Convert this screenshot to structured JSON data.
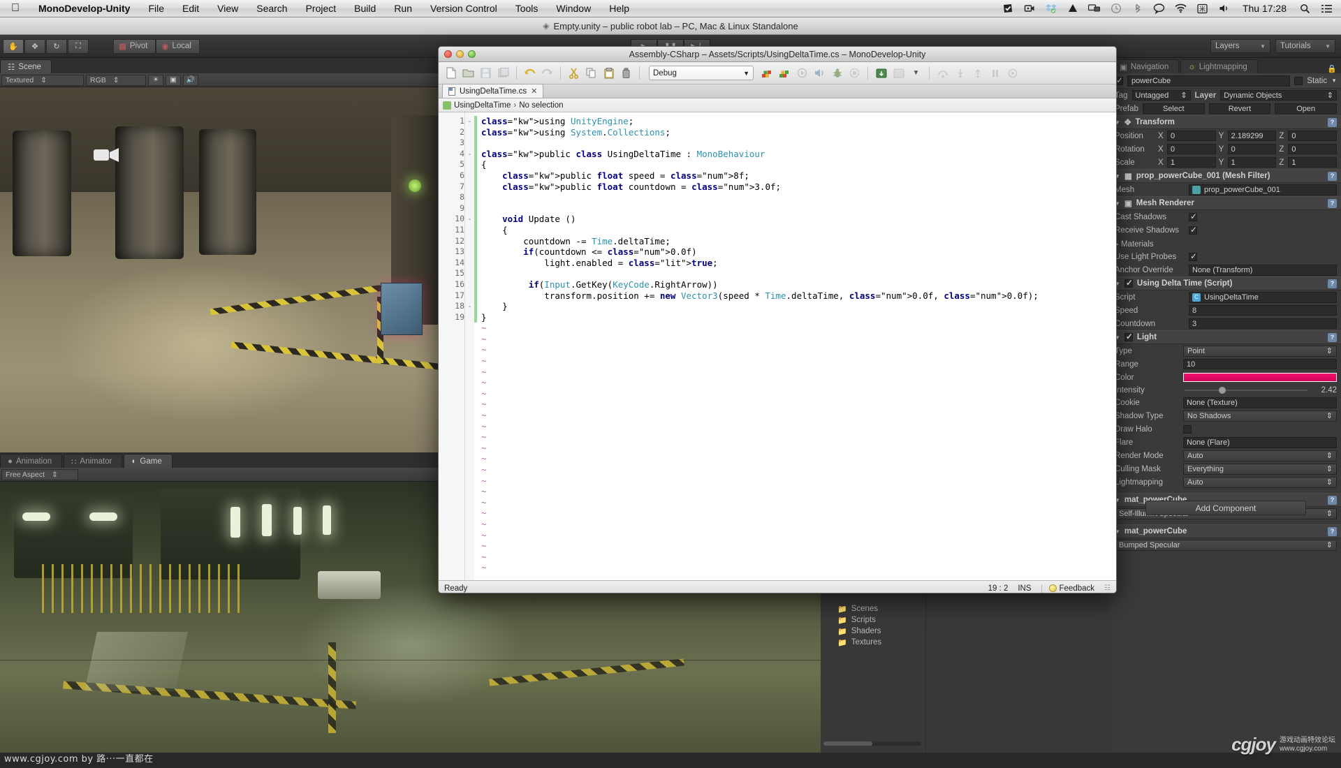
{
  "menubar": {
    "apple_icon": "apple-icon",
    "app_name": "MonoDevelop-Unity",
    "items": [
      "File",
      "Edit",
      "View",
      "Search",
      "Project",
      "Build",
      "Run",
      "Version Control",
      "Tools",
      "Window",
      "Help"
    ],
    "status_icons": [
      "checkmark-badge-icon",
      "screen-record-icon",
      "dropbox-icon",
      "google-drive-icon",
      "display-mirror-icon",
      "time-machine-icon",
      "bluetooth-icon",
      "chat-bubble-icon",
      "wifi-icon",
      "input-menu-icon",
      "volume-icon"
    ],
    "clock": "Thu 17:28",
    "search_icon": "search-icon",
    "notification_icon": "notification-center-icon"
  },
  "unity": {
    "title": "Empty.unity – public robot lab – PC, Mac & Linux Standalone",
    "title_icon": "unity-icon",
    "toolbar": {
      "tools": [
        "hand-tool",
        "move-tool",
        "rotate-tool",
        "scale-tool"
      ],
      "pivot_label": "Pivot",
      "local_label": "Local",
      "play_icon": "play-icon",
      "pause_icon": "pause-icon",
      "step_icon": "step-icon",
      "layers_label": "Layers",
      "tutorials_label": "Tutorials"
    },
    "scene_panel": {
      "tab_label": "Scene",
      "draw_mode": "Textured",
      "render_mode": "RGB",
      "toggles": [
        "lighting-icon",
        "image-effects-icon",
        "audio-icon"
      ]
    },
    "game_panel": {
      "tabs": [
        {
          "label": "Animation",
          "icon": "animation-icon",
          "active": false
        },
        {
          "label": "Animator",
          "icon": "animator-icon",
          "active": false
        },
        {
          "label": "Game",
          "icon": "game-icon",
          "active": true
        }
      ],
      "aspect": "Free Aspect"
    },
    "project_panel": {
      "folders": [
        "Scenes",
        "Scripts",
        "Shaders",
        "Textures"
      ],
      "folder_icon": "folder-icon"
    },
    "inspector": {
      "tabs": [
        {
          "label": "Navigation",
          "icon": "navigation-icon"
        },
        {
          "label": "Lightmapping",
          "icon": "lightmapping-icon"
        }
      ],
      "lock_icon": "lock-icon",
      "object_name": "powerCube",
      "static_label": "Static",
      "tag_label": "Tag",
      "tag_value": "Untagged",
      "layer_label": "Layer",
      "layer_value": "Dynamic Objects",
      "prefab_label": "Prefab",
      "prefab_buttons": [
        "Select",
        "Revert",
        "Open"
      ],
      "transform": {
        "header": "Transform",
        "rows": [
          {
            "label": "Position",
            "x": "0",
            "y": "2.189299",
            "z": "0"
          },
          {
            "label": "Rotation",
            "x": "0",
            "y": "0",
            "z": "0"
          },
          {
            "label": "Scale",
            "x": "1",
            "y": "1",
            "z": "1"
          }
        ]
      },
      "mesh_filter": {
        "header": "prop_powerCube_001 (Mesh Filter)",
        "mesh_label": "Mesh",
        "mesh_value": "prop_powerCube_001"
      },
      "mesh_renderer": {
        "header": "Mesh Renderer",
        "rows": [
          {
            "label": "Cast Shadows",
            "checked": true
          },
          {
            "label": "Receive Shadows",
            "checked": true
          },
          {
            "label": "Use Light Probes",
            "checked": true
          }
        ],
        "anchor_label": "Anchor Override",
        "anchor_value": "None (Transform)"
      },
      "script_comp": {
        "header": "Using Delta Time (Script)",
        "script_label": "Script",
        "script_value": "UsingDeltaTime",
        "speed_label": "Speed",
        "speed_value": "8",
        "countdown_label": "Countdown",
        "countdown_value": "3"
      },
      "light_comp": {
        "header": "Light",
        "type_label": "Type",
        "type_value": "Point",
        "range_label": "Range",
        "range_value": "10",
        "color_label": "Color",
        "color_value": "#F2126B",
        "intensity_label": "Intensity",
        "intensity_value": "2.42",
        "cookie_label": "Cookie",
        "cookie_value": "None (Texture)",
        "shadow_label": "Shadow Type",
        "shadow_value": "No Shadows",
        "draw_halo_label": "Draw Halo",
        "flare_label": "Flare",
        "flare_value": "None (Flare)",
        "render_mode_label": "Render Mode",
        "render_mode_value": "Auto",
        "culling_label": "Culling Mask",
        "culling_value": "Everything",
        "lightmapping_label": "Lightmapping",
        "lightmapping_value": "Auto"
      },
      "materials": [
        {
          "name": "mat_powerCube",
          "shader": "Self-Illumin/Specular"
        },
        {
          "name": "mat_powerCube",
          "shader": "Bumped Specular"
        }
      ],
      "add_component": "Add Component"
    }
  },
  "monodevelop": {
    "title": "Assembly-CSharp – Assets/Scripts/UsingDeltaTime.cs – MonoDevelop-Unity",
    "toolbar": {
      "icons": [
        "new-file-icon",
        "open-file-icon",
        "save-icon",
        "save-all-icon",
        "undo-icon",
        "redo-icon",
        "cut-icon",
        "copy-icon",
        "paste-icon",
        "trash-icon",
        "build-icon",
        "rebuild-icon",
        "run-icon",
        "run-with-icon",
        "debug-icon",
        "stop-icon",
        "attach-icon",
        "detach-icon",
        "dropdown-icon",
        "step-over-icon",
        "step-into-icon",
        "step-out-icon",
        "pause-icon",
        "continue-icon"
      ],
      "config_value": "Debug"
    },
    "tab": {
      "label": "UsingDeltaTime.cs",
      "close_icon": "close-icon"
    },
    "breadcrumb": {
      "class": "UsingDeltaTime",
      "separator": "›",
      "member": "No selection"
    },
    "code_lines": [
      {
        "n": 1,
        "fold": "-",
        "changed": true,
        "text": "using UnityEngine;"
      },
      {
        "n": 2,
        "fold": "",
        "changed": true,
        "text": "using System.Collections;"
      },
      {
        "n": 3,
        "fold": "",
        "changed": true,
        "text": ""
      },
      {
        "n": 4,
        "fold": "-",
        "changed": true,
        "text": "public class UsingDeltaTime : MonoBehaviour"
      },
      {
        "n": 5,
        "fold": "",
        "changed": true,
        "text": "{"
      },
      {
        "n": 6,
        "fold": "",
        "changed": true,
        "text": "    public float speed = 8f;"
      },
      {
        "n": 7,
        "fold": "",
        "changed": true,
        "text": "    public float countdown = 3.0f;"
      },
      {
        "n": 8,
        "fold": "",
        "changed": true,
        "text": ""
      },
      {
        "n": 9,
        "fold": "",
        "changed": true,
        "text": ""
      },
      {
        "n": 10,
        "fold": "-",
        "changed": true,
        "text": "    void Update ()"
      },
      {
        "n": 11,
        "fold": "",
        "changed": true,
        "text": "    {"
      },
      {
        "n": 12,
        "fold": "",
        "changed": true,
        "text": "        countdown -= Time.deltaTime;"
      },
      {
        "n": 13,
        "fold": "",
        "changed": true,
        "text": "        if(countdown <= 0.0f)"
      },
      {
        "n": 14,
        "fold": "",
        "changed": true,
        "text": "            light.enabled = true;"
      },
      {
        "n": 15,
        "fold": "",
        "changed": true,
        "text": ""
      },
      {
        "n": 16,
        "fold": "",
        "changed": true,
        "text": "         if(Input.GetKey(KeyCode.RightArrow))"
      },
      {
        "n": 17,
        "fold": "",
        "changed": true,
        "text": "            transform.position += new Vector3(speed * Time.deltaTime, 0.0f, 0.0f);"
      },
      {
        "n": 18,
        "fold": "-",
        "changed": true,
        "text": "    }"
      },
      {
        "n": 19,
        "fold": "",
        "changed": true,
        "text": "}"
      }
    ],
    "virtual_line_marker": "~",
    "virtual_line_count": 23,
    "status": {
      "message": "Ready",
      "caret": "19 : 2",
      "insert_mode": "INS",
      "feedback": "Feedback"
    }
  },
  "footer": {
    "credit": "www.cgjoy.com by 路···一直都在",
    "watermark_logo": "cgjoy",
    "watermark_line1": "游戏动画特效论坛",
    "watermark_line2": "www.cgjoy.com"
  }
}
